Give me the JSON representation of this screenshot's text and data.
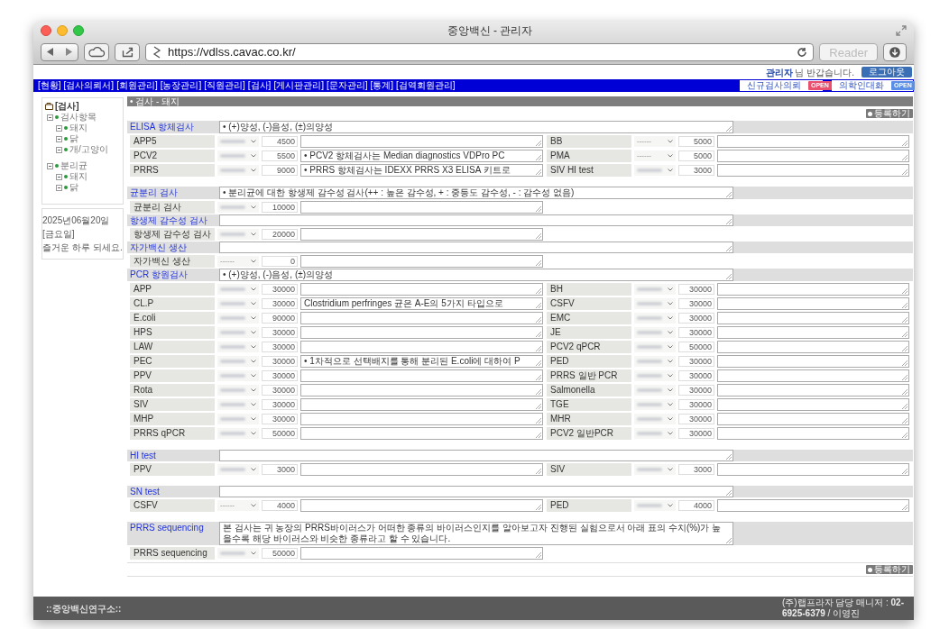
{
  "browser": {
    "title": "중앙백신 - 관리자",
    "url": "https://vdlss.cavac.co.kr/",
    "reader": "Reader"
  },
  "header": {
    "user": "관리자",
    "greeting": "님 반갑습니다.",
    "logout": "로그아웃"
  },
  "nav": {
    "items": [
      "[현황]",
      "[검사의뢰서]",
      "[회원관리]",
      "[농장관리]",
      "[직원관리]",
      "[검사]",
      "[게시판관리]",
      "[문자관리]",
      "[통계]",
      "[검역회원관리]"
    ],
    "panels": [
      {
        "label": "신규검사의뢰",
        "badge": "OPEN",
        "color": "#e8506e"
      },
      {
        "label": "의학인대화",
        "badge": "OPEN",
        "color": "#5b8ee6"
      }
    ]
  },
  "sidebar": {
    "tree": [
      {
        "label": "[검사]",
        "children": [
          {
            "label": "검사항목",
            "children": [
              {
                "label": "돼지"
              },
              {
                "label": "닭"
              },
              {
                "label": "개/고양이"
              }
            ]
          },
          {
            "label": "분리균",
            "children": [
              {
                "label": "돼지"
              },
              {
                "label": "닭"
              }
            ]
          }
        ]
      }
    ],
    "date": "2025년06월20일 [금요일]",
    "message": "즐거운 하루 되세요."
  },
  "breadcrumb": "• 검사 - 돼지",
  "register_top": "등록하기",
  "sections": [
    {
      "title": "ELISA 항체검사",
      "note": "• (+)양성, (-)음성, (±)의양성",
      "left": [
        {
          "name": "APP5",
          "price": "4500"
        },
        {
          "name": "PCV2",
          "price": "5500",
          "memo": "• PCV2 항체검사는 Median diagnostics VDPro PC"
        },
        {
          "name": "PRRS",
          "price": "9000",
          "memo": "• PRRS 항체검사는 IDEXX PRRS X3 ELISA 키트로"
        }
      ],
      "right": [
        {
          "name": "BB",
          "select": "------",
          "price": "5000"
        },
        {
          "name": "PMA",
          "select": "------",
          "price": "5000"
        },
        {
          "name": "SIV HI test",
          "price": "3000"
        }
      ]
    },
    {
      "title": "균분리 검사",
      "note": "• 분리균에 대한 항생제 감수성 검사(++ : 높은 감수성, + : 중등도 감수성, - : 감수성 없음)",
      "left": [
        {
          "name": "균분리 검사",
          "price": "10000"
        }
      ]
    },
    {
      "title": "항생제 감수성 검사",
      "left": [
        {
          "name": "항생제 감수성 검사",
          "price": "20000"
        }
      ]
    },
    {
      "title": "자가백신 생산",
      "left": [
        {
          "name": "자가백신 생산",
          "select": "------",
          "price": "0"
        }
      ]
    },
    {
      "title": "PCR 항원검사",
      "note": "• (+)양성, (-)음성, (±)의양성",
      "left": [
        {
          "name": "APP",
          "price": "30000"
        },
        {
          "name": "CL.P",
          "price": "30000",
          "memo": "Clostridium perfringes 균은 A-E의 5가지 타입으로"
        },
        {
          "name": "E.coli",
          "price": "90000"
        },
        {
          "name": "HPS",
          "price": "30000"
        },
        {
          "name": "LAW",
          "price": "30000"
        },
        {
          "name": "PEC",
          "price": "30000",
          "memo": "• 1차적으로 선택배지를 통해 분리된 E.coli에 대하여 P"
        },
        {
          "name": "PPV",
          "price": "30000"
        },
        {
          "name": "Rota",
          "price": "30000"
        },
        {
          "name": "SIV",
          "price": "30000"
        },
        {
          "name": "MHP",
          "price": "30000"
        },
        {
          "name": "PRRS qPCR",
          "price": "50000"
        }
      ],
      "right": [
        {
          "name": "BH",
          "price": "30000"
        },
        {
          "name": "CSFV",
          "price": "30000"
        },
        {
          "name": "EMC",
          "price": "30000"
        },
        {
          "name": "JE",
          "price": "30000"
        },
        {
          "name": "PCV2 qPCR",
          "price": "50000"
        },
        {
          "name": "PED",
          "price": "30000"
        },
        {
          "name": "PRRS 일반 PCR",
          "price": "30000"
        },
        {
          "name": "Salmonella",
          "price": "30000"
        },
        {
          "name": "TGE",
          "price": "30000"
        },
        {
          "name": "MHR",
          "price": "30000"
        },
        {
          "name": "PCV2 일반PCR",
          "price": "30000"
        }
      ]
    },
    {
      "title": "HI test",
      "left": [
        {
          "name": "PPV",
          "price": "3000"
        }
      ],
      "right": [
        {
          "name": "SIV",
          "price": "3000"
        }
      ]
    },
    {
      "title": "SN test",
      "left": [
        {
          "name": "CSFV",
          "select": "------",
          "price": "4000"
        }
      ],
      "right": [
        {
          "name": "PED",
          "price": "4000"
        }
      ]
    },
    {
      "title": "PRRS sequencing",
      "note": "본 검사는 귀 농장의 PRRS바이러스가 어떠한 종류의 바이러스인지를 알아보고자 진행된 실험으로서 아래 표의 수치(%)가 높을수록 해당 바이러스와 비슷한 종류라고 할 수 있습니다.",
      "left": [
        {
          "name": "PRRS sequencing",
          "price": "50000"
        }
      ]
    }
  ],
  "register_bottom": "등록하기",
  "footer": {
    "brand": "::중앙백신연구소::",
    "contact": "(주)랩프라자 담당 매니저 : **02-6925-6379** / 이영진"
  }
}
